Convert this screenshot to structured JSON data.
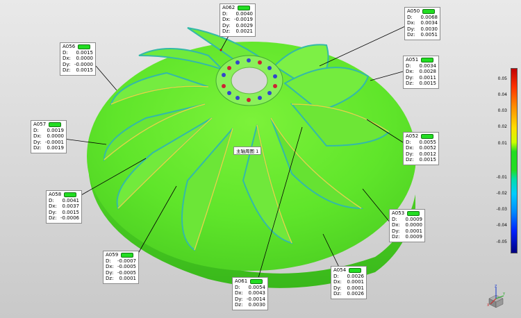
{
  "center_label": "主轴周图 1",
  "legend": {
    "ticks": [
      "0.05",
      "0.04",
      "0.03",
      "0.02",
      "0.01",
      "-0.01",
      "-0.02",
      "-0.03",
      "-0.04",
      "-0.05"
    ]
  },
  "triad": {
    "z": "Z",
    "y": "Y",
    "x": "X"
  },
  "callouts": [
    {
      "id": "A062",
      "D": "0.0040",
      "Dx": "-0.0019",
      "Dy": "0.0029",
      "Dz": "0.0021"
    },
    {
      "id": "A050",
      "D": "0.0068",
      "Dx": "0.0034",
      "Dy": "0.0030",
      "Dz": "0.0051"
    },
    {
      "id": "A056",
      "D": "0.0015",
      "Dx": "0.0000",
      "Dy": "-0.0000",
      "Dz": "0.0015"
    },
    {
      "id": "A051",
      "D": "0.0034",
      "Dx": "0.0028",
      "Dy": "0.0011",
      "Dz": "0.0015"
    },
    {
      "id": "A057",
      "D": "0.0019",
      "Dx": "0.0000",
      "Dy": "-0.0001",
      "Dz": "0.0019"
    },
    {
      "id": "A052",
      "D": "0.0055",
      "Dx": "0.0052",
      "Dy": "0.0012",
      "Dz": "0.0015"
    },
    {
      "id": "A058",
      "D": "0.0041",
      "Dx": "0.0037",
      "Dy": "0.0015",
      "Dz": "-0.0006"
    },
    {
      "id": "A053",
      "D": "0.0009",
      "Dx": "0.0000",
      "Dy": "0.0001",
      "Dz": "0.0009"
    },
    {
      "id": "A059",
      "D": "-0.0007",
      "Dx": "-0.0005",
      "Dy": "-0.0005",
      "Dz": "0.0001"
    },
    {
      "id": "A054",
      "D": "0.0026",
      "Dx": "0.0001",
      "Dy": "0.0001",
      "Dz": "0.0026"
    },
    {
      "id": "A061",
      "D": "0.0054",
      "Dx": "0.0043",
      "Dy": "-0.0014",
      "Dz": "0.0030"
    }
  ],
  "row_labels": {
    "D": "D:",
    "Dx": "Dx:",
    "Dy": "Dy:",
    "Dz": "Dz:"
  }
}
